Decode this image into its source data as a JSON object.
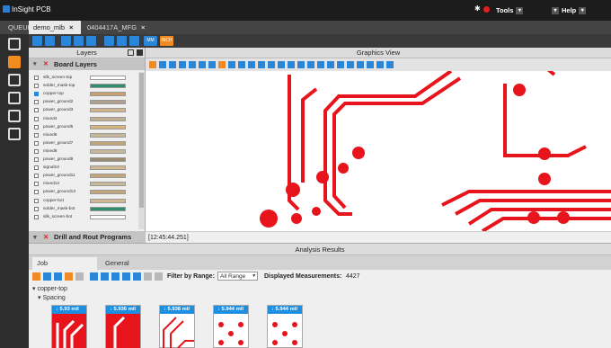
{
  "app": {
    "title": "InSight PCB"
  },
  "titlebar": {
    "tools_label": "Tools",
    "help_label": "Help"
  },
  "tabs": [
    {
      "label": "QUEUE"
    },
    {
      "label": "demo_mlb"
    },
    {
      "label": "0404417A_MFG"
    }
  ],
  "toolbar": {
    "mm_label": "MM",
    "inch_label": "INCH"
  },
  "layers_panel": {
    "title": "Layers",
    "board_layers_title": "Board Layers",
    "drill_title": "Drill and Rout Programs",
    "layers": [
      {
        "name": "silk_screen-top",
        "checked": false,
        "color": "#ffffff"
      },
      {
        "name": "solder_mask-top",
        "checked": false,
        "color": "#2d8f6e"
      },
      {
        "name": "copper-top",
        "checked": true,
        "color": "#c8a070"
      },
      {
        "name": "power_ground2",
        "checked": false,
        "color": "#b0a090"
      },
      {
        "name": "power_ground3",
        "checked": false,
        "color": "#d2b48c"
      },
      {
        "name": "mixed4",
        "checked": false,
        "color": "#c0b090"
      },
      {
        "name": "power_ground5",
        "checked": false,
        "color": "#d4b47c"
      },
      {
        "name": "mixed6",
        "checked": false,
        "color": "#c8b89a"
      },
      {
        "name": "power_ground7",
        "checked": false,
        "color": "#c2a57a"
      },
      {
        "name": "mixed8",
        "checked": false,
        "color": "#c8b89a"
      },
      {
        "name": "power_ground9",
        "checked": false,
        "color": "#9a8a70"
      },
      {
        "name": "signal10",
        "checked": false,
        "color": "#d0b890"
      },
      {
        "name": "power_ground11",
        "checked": false,
        "color": "#c2a57a"
      },
      {
        "name": "mixed12",
        "checked": false,
        "color": "#c8b89a"
      },
      {
        "name": "power_ground13",
        "checked": false,
        "color": "#c2a57a"
      },
      {
        "name": "copper-bot",
        "checked": false,
        "color": "#d0b890"
      },
      {
        "name": "solder_mask-bot",
        "checked": false,
        "color": "#2d8f6e"
      },
      {
        "name": "silk_screen-bot",
        "checked": false,
        "color": "#ffffff"
      }
    ]
  },
  "graphics_view": {
    "title": "Graphics View",
    "status_time": "[12:45:44.251]"
  },
  "analysis": {
    "title": "Analysis Results",
    "tabs": [
      {
        "label": "Job Measurements"
      },
      {
        "label": "General"
      }
    ],
    "filter_label": "Filter by Range:",
    "filter_value": "All Range",
    "displayed_label": "Displayed Measurements:",
    "displayed_count": "4427",
    "tree_layer": "copper-top",
    "tree_category": "Spacing",
    "thumbs": [
      {
        "value": "5.93 mil"
      },
      {
        "value": "5.936 mil"
      },
      {
        "value": "5.938 mil"
      },
      {
        "value": "5.944 mil"
      },
      {
        "value": "5.944 mil"
      }
    ]
  },
  "colors": {
    "accent": "#2a86d9",
    "trace": "#e8141c",
    "highlight": "#f08a24"
  }
}
